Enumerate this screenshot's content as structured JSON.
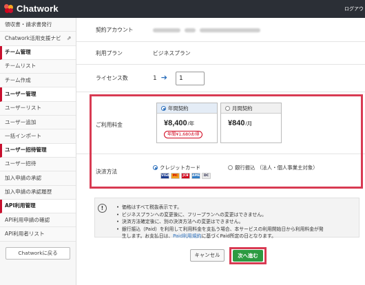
{
  "header": {
    "logo_text": "Chatwork",
    "logout_label": "ログアウ"
  },
  "sidebar": {
    "items": [
      {
        "label": "領収書・請求書発行",
        "type": "item"
      },
      {
        "label": "Chatwork活用支援ナビ",
        "type": "item",
        "external": true
      },
      {
        "label": "チーム管理",
        "type": "header"
      },
      {
        "label": "チームリスト",
        "type": "item"
      },
      {
        "label": "チーム作成",
        "type": "item"
      },
      {
        "label": "ユーザー管理",
        "type": "header"
      },
      {
        "label": "ユーザーリスト",
        "type": "item"
      },
      {
        "label": "ユーザー追加",
        "type": "item"
      },
      {
        "label": "一括インポート",
        "type": "item"
      },
      {
        "label": "ユーザー招待管理",
        "type": "header"
      },
      {
        "label": "ユーザー招待",
        "type": "item"
      },
      {
        "label": "加入申請の承認",
        "type": "item"
      },
      {
        "label": "加入申請の承認履歴",
        "type": "item"
      },
      {
        "label": "API利用管理",
        "type": "header"
      },
      {
        "label": "API利用申請の確認",
        "type": "item"
      },
      {
        "label": "API利用者リスト",
        "type": "item"
      }
    ],
    "back_button": "Chatworkに戻る"
  },
  "form": {
    "account": {
      "label": "契約アカウント",
      "value_hidden": true
    },
    "plan": {
      "label": "利用プラン",
      "value": "ビジネスプラン"
    },
    "license": {
      "label": "ライセンス数",
      "current": "1",
      "new_value": "1"
    },
    "fee": {
      "label": "ご利用料金",
      "options": [
        {
          "name": "年間契約",
          "price": "¥8,400",
          "unit": "/年",
          "discount": "年間¥1,680お得",
          "selected": true
        },
        {
          "name": "月間契約",
          "price": "¥840",
          "unit": "/月",
          "selected": false
        }
      ]
    },
    "payment": {
      "label": "決済方法",
      "options": [
        {
          "name": "クレジットカード",
          "selected": true
        },
        {
          "name": "銀行振込 （法人・個人事業主対象）",
          "selected": false
        }
      ],
      "card_brands": [
        "VISA",
        "MC",
        "JCB",
        "AMEX",
        "DC"
      ]
    }
  },
  "notice": {
    "icon": "!",
    "lines": [
      "価格はすべて税抜表示です。",
      "ビジネスプランへの変更後に、フリープランへの変更はできません。",
      "決済方法確定後に、別の決済方法への変更はできません。",
      "銀行振込（Paid）を利用して利用料金を支払う場合、本サービスの利用開始日から利用料金が発"
    ],
    "last_line_pre": "生します。お支払日は、",
    "last_line_link": "Paid利用規約",
    "last_line_post": "に基づくPaid所定の日となります。"
  },
  "actions": {
    "cancel": "キャンセル",
    "next": "次へ進む"
  },
  "colors": {
    "accent_red": "#d83a52",
    "brand_green": "#2c9a41",
    "link_blue": "#2a6ebb",
    "header_bg": "#2b2f36"
  }
}
